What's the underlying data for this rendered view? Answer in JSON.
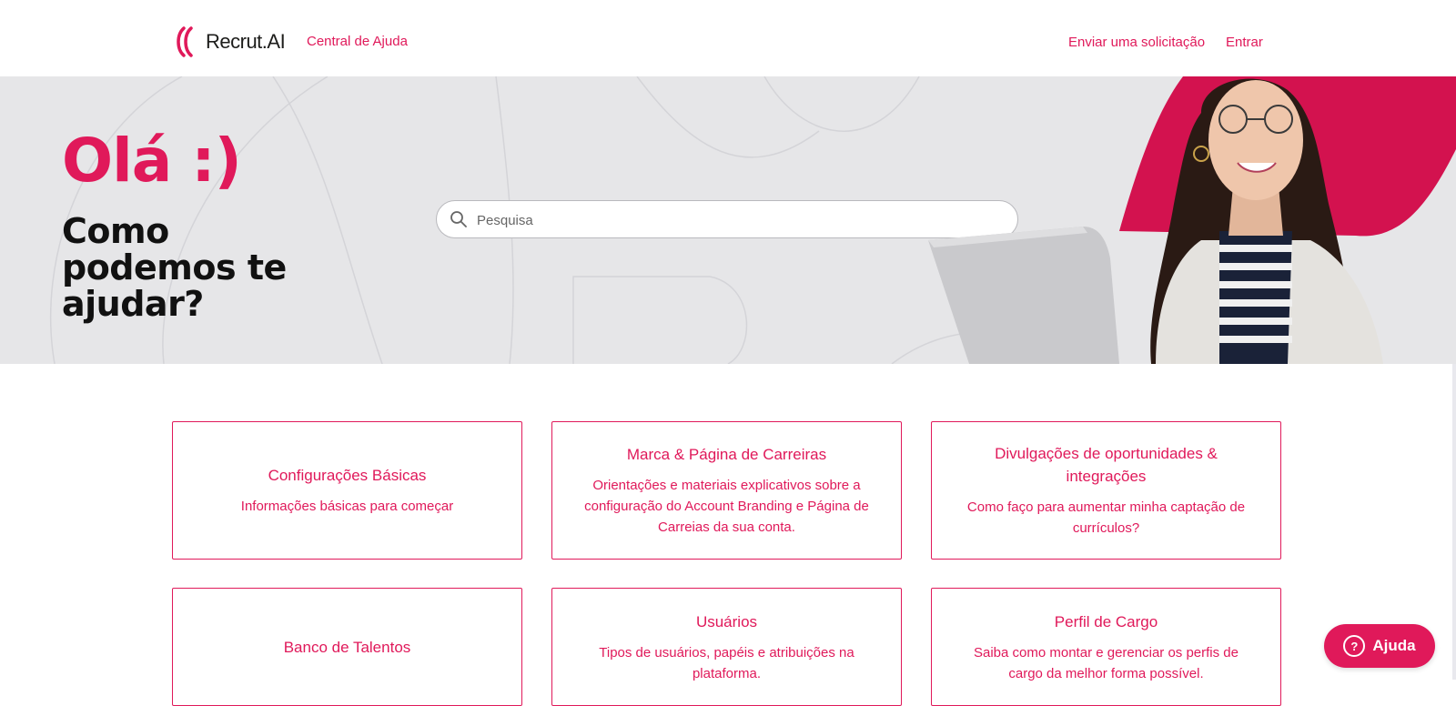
{
  "header": {
    "logo_text": "Recrut.",
    "logo_ai": "AI",
    "subtitle": "Central de Ajuda",
    "nav": {
      "send_request": "Enviar uma solicitação",
      "login": "Entrar"
    }
  },
  "hero": {
    "greeting": "Olá :)",
    "headline": "Como podemos te ajudar?",
    "search_placeholder": "Pesquisa"
  },
  "categories": [
    {
      "title": "Configurações Básicas",
      "description": "Informações básicas para começar"
    },
    {
      "title": "Marca & Página de Carreiras",
      "description": "Orientações e materiais explicativos sobre a configuração do Account Branding e Página de Carreias da sua conta."
    },
    {
      "title": "Divulgações de oportunidades & integrações",
      "description": "Como faço para aumentar minha captação de currículos?"
    },
    {
      "title": "Banco de Talentos",
      "description": ""
    },
    {
      "title": "Usuários",
      "description": "Tipos de usuários, papéis e atribuições na plataforma."
    },
    {
      "title": "Perfil de Cargo",
      "description": "Saiba como montar e gerenciar os perfis de cargo da melhor forma possível."
    }
  ],
  "help_widget": {
    "label": "Ajuda",
    "icon": "?"
  },
  "colors": {
    "brand": "#e0195a",
    "hero_bg": "#e6e6e8"
  }
}
